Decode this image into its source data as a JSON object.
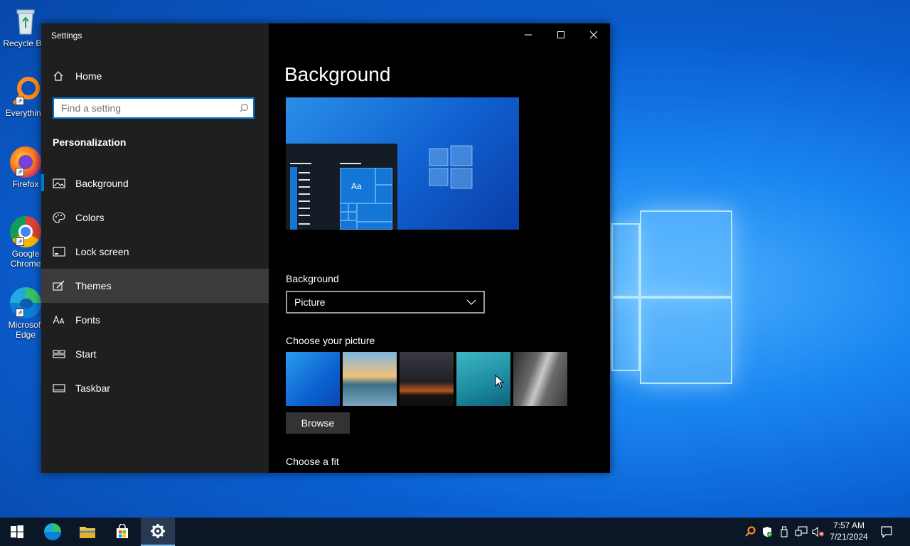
{
  "desktop": {
    "icons": [
      {
        "label": "Recycle Bin",
        "icon": "recycle-bin-icon"
      },
      {
        "label": "Everything",
        "icon": "everything-search-icon"
      },
      {
        "label": "Firefox",
        "icon": "firefox-icon"
      },
      {
        "label": "Google Chrome",
        "icon": "chrome-icon"
      },
      {
        "label": "Microsoft Edge",
        "icon": "edge-icon"
      }
    ]
  },
  "window": {
    "title": "Settings",
    "controls": {
      "minimize": "minimize-icon",
      "maximize": "maximize-icon",
      "close": "close-icon"
    }
  },
  "sidebar": {
    "home_label": "Home",
    "search_placeholder": "Find a setting",
    "section_title": "Personalization",
    "items": [
      {
        "label": "Background",
        "icon": "picture-icon"
      },
      {
        "label": "Colors",
        "icon": "palette-icon"
      },
      {
        "label": "Lock screen",
        "icon": "lock-screen-icon"
      },
      {
        "label": "Themes",
        "icon": "brush-icon"
      },
      {
        "label": "Fonts",
        "icon": "fonts-icon"
      },
      {
        "label": "Start",
        "icon": "start-icon"
      },
      {
        "label": "Taskbar",
        "icon": "taskbar-icon"
      }
    ],
    "selected_item": "Themes",
    "accent": "#0078d7"
  },
  "main": {
    "title": "Background",
    "preview_tile_text": "Aa",
    "background_label": "Background",
    "background_value": "Picture",
    "choose_picture_label": "Choose your picture",
    "browse_label": "Browse",
    "choose_fit_label": "Choose a fit"
  },
  "taskbar": {
    "apps": [
      "start-icon",
      "edge-icon",
      "file-explorer-icon",
      "store-icon",
      "settings-icon"
    ],
    "active_app": "settings-icon",
    "tray_icons": [
      "everything-icon",
      "security-icon",
      "usb-icon",
      "network-icon",
      "volume-muted-icon"
    ],
    "time": "7:57 AM",
    "date": "7/21/2024",
    "notification_icon": "action-center-icon"
  }
}
